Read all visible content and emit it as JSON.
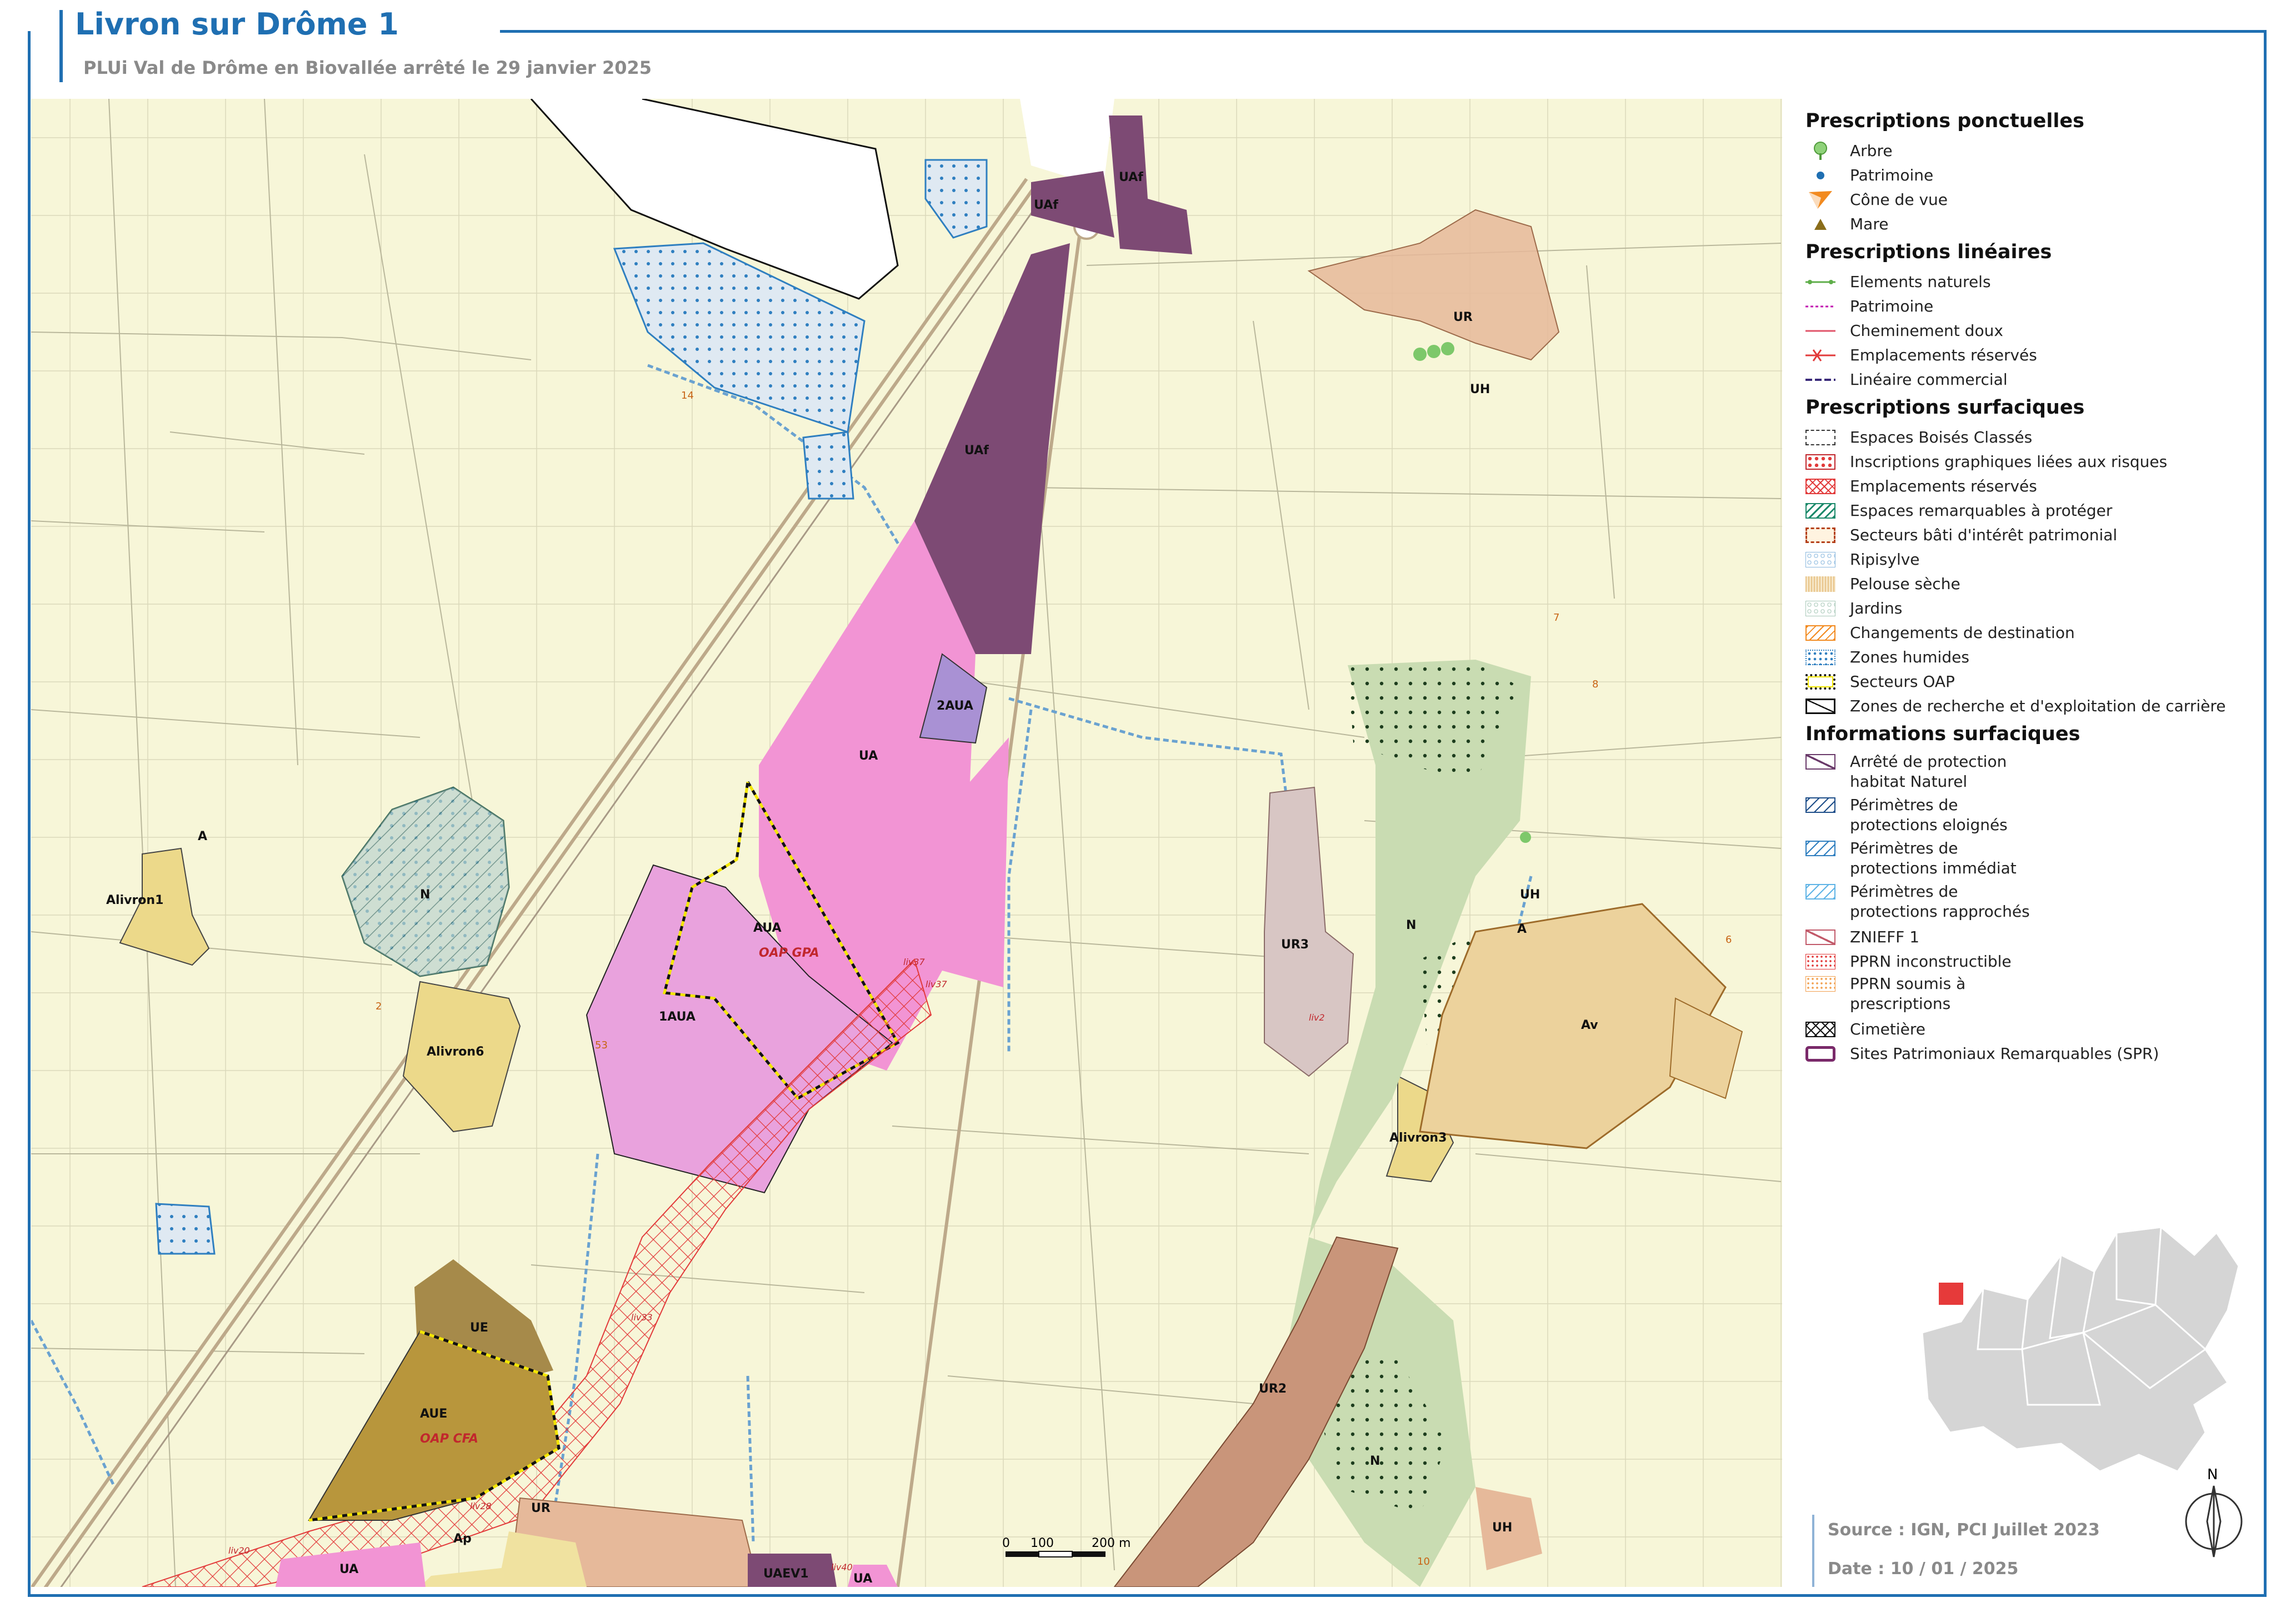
{
  "header": {
    "title": "Livron sur Drôme 1",
    "subtitle": "PLUi Val de Drôme en Biovallée arrêté le 29 janvier 2025"
  },
  "colors": {
    "frame": "#1f6fb2",
    "base": "#f7f6d8",
    "zone_UA": "#f294d4",
    "zone_AUA": "#e9a2dd",
    "zone_UAf": "#7d4a74",
    "zone_2AUA": "#a991d4",
    "zone_N": "#c9dcb2",
    "zone_Alivron": "#ecd98a",
    "zone_UR": "#d7a88a",
    "zone_Av": "#ecd29c",
    "zone_AUE": "#b8963c",
    "zone_UR3": "#d8c6c4"
  },
  "map": {
    "zone_labels": {
      "uaf_top_right": "UAf",
      "uaf_top": "UAf",
      "uaf_mid": "UAf",
      "ur_village": "UR",
      "uh_village": "UH",
      "ua_main": "UA",
      "aua_2": "2AUA",
      "aua": "AUA",
      "aua_1": "1AUA",
      "oap_gpa": "OAP GPA",
      "a_west": "A",
      "n_west": "N",
      "alivron1": "Alivron1",
      "alivron6": "Alivron6",
      "ur3": "UR3",
      "n_east": "N",
      "uh_east": "UH",
      "a_east": "A",
      "av": "Av",
      "alivron3": "Alivron3",
      "ue": "UE",
      "aue": "AUE",
      "oap_cfa": "OAP CFA",
      "ur_south": "UR",
      "ap": "Ap",
      "ua_south": "UA",
      "uaev1": "UAEV1",
      "ua_bottom": "UA",
      "ur2": "UR2",
      "n_south": "N",
      "uh_south": "UH"
    },
    "small_labels": {
      "l14": "14",
      "l2": "2",
      "l53": "53",
      "l7": "7",
      "l8": "8",
      "l6": "6",
      "l10": "10",
      "liv37a": "liv37",
      "liv37b": "liv37",
      "liv2": "liv2",
      "liv33": "liv33",
      "liv28": "liv28",
      "liv20": "liv20",
      "liv40": "liv40"
    },
    "scale": {
      "zero": "0",
      "mid": "100",
      "end": "200 m"
    },
    "north_label": "N"
  },
  "legend": {
    "ponctuelles_title": "Prescriptions ponctuelles",
    "ponctuelles": [
      "Arbre",
      "Patrimoine",
      "Cône de vue",
      "Mare"
    ],
    "lineaires_title": "Prescriptions linéaires",
    "lineaires": [
      "Elements naturels",
      "Patrimoine",
      "Cheminement doux",
      "Emplacements réservés",
      "Linéaire commercial"
    ],
    "surfaciques_title": "Prescriptions surfaciques",
    "surfaciques": [
      "Espaces Boisés Classés",
      "Inscriptions graphiques liées aux risques",
      "Emplacements réservés",
      "Espaces remarquables à protéger",
      "Secteurs bâti d'intérêt patrimonial",
      "Ripisylve",
      "Pelouse sèche",
      "Jardins",
      "Changements de destination",
      "Zones humides",
      "Secteurs OAP",
      "Zones de recherche et d'exploitation de carrière"
    ],
    "informations_title": "Informations surfaciques",
    "informations": [
      "Arrêté de protection\nhabitat Naturel",
      "Périmètres de\nprotections eloignés",
      "Périmètres de\nprotections immédiat",
      "Périmètres de\nprotections rapprochés",
      "ZNIEFF 1",
      "PPRN inconstructible",
      "PPRN soumis à\nprescriptions",
      "Cimetière",
      "Sites Patrimoniaux Remarquables (SPR)"
    ]
  },
  "footer": {
    "source": "Source : IGN, PCI Juillet 2023",
    "date": "Date : 10 / 01 / 2025"
  }
}
